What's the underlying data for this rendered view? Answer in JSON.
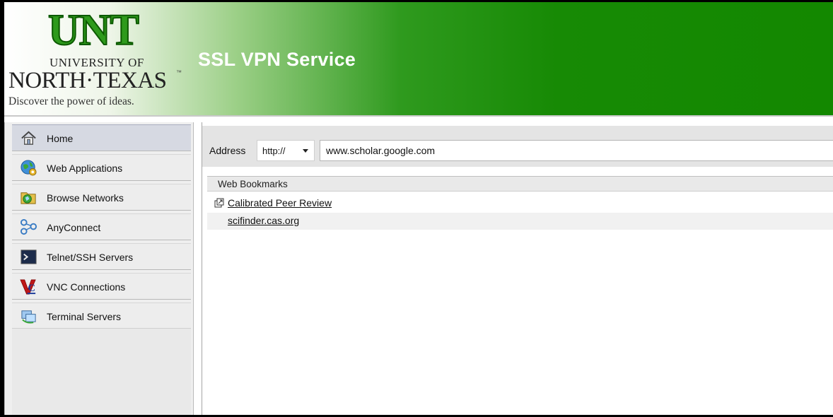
{
  "header": {
    "logo": {
      "acronym": "UNT",
      "university_line1": "UNIVERSITY OF",
      "university_line2": "NORTH·TEXAS",
      "trademark": "™",
      "tagline": "Discover the power of ideas."
    },
    "title": "SSL VPN Service"
  },
  "sidebar": {
    "items": [
      {
        "label": "Home",
        "icon": "home-icon",
        "active": true
      },
      {
        "label": "Web Applications",
        "icon": "globe-gear-icon"
      },
      {
        "label": "Browse Networks",
        "icon": "network-folder-icon"
      },
      {
        "label": "AnyConnect",
        "icon": "anyconnect-icon"
      },
      {
        "label": "Telnet/SSH Servers",
        "icon": "terminal-icon"
      },
      {
        "label": "VNC Connections",
        "icon": "vnc-icon"
      },
      {
        "label": "Terminal Servers",
        "icon": "terminal-server-icon"
      }
    ]
  },
  "address": {
    "label": "Address",
    "protocol": "http://",
    "url": "www.scholar.google.com"
  },
  "bookmarks": {
    "title": "Web Bookmarks",
    "items": [
      {
        "label": "Calibrated Peer Review",
        "icon": "external-link-icon"
      },
      {
        "label": "scifinder.cas.org"
      }
    ]
  },
  "colors": {
    "header_green": "#138800",
    "logo_green": "#2e9a1c",
    "active_nav": "#d6d9e2"
  }
}
